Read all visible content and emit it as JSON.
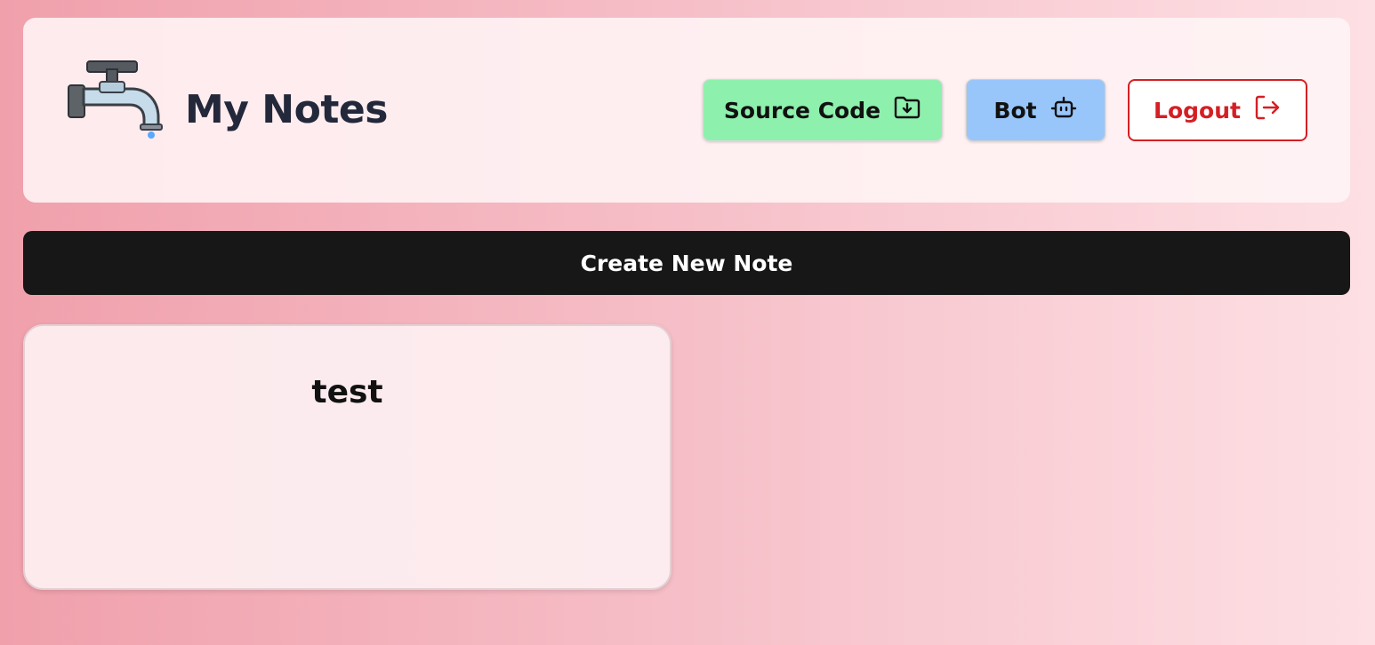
{
  "header": {
    "title": "My Notes",
    "logo_icon": "water-faucet-icon",
    "buttons": {
      "source_code": {
        "label": "Source Code",
        "icon": "folder-download-icon",
        "color": "#8ef0ad"
      },
      "bot": {
        "label": "Bot",
        "icon": "robot-icon",
        "color": "#98c6fb"
      },
      "logout": {
        "label": "Logout",
        "icon": "logout-arrow-icon",
        "color": "#d41f24"
      }
    }
  },
  "main": {
    "create_label": "Create New Note",
    "notes": [
      {
        "title": "test"
      }
    ]
  }
}
